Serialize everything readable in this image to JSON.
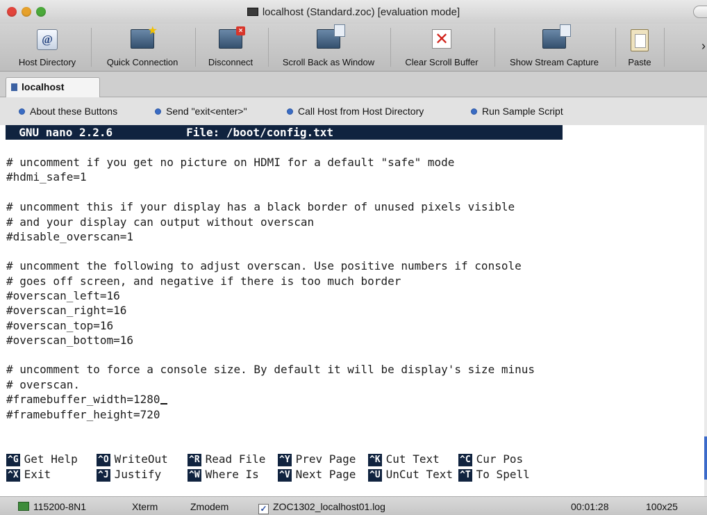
{
  "window": {
    "title": "localhost (Standard.zoc) [evaluation mode]"
  },
  "toolbar": {
    "buttons": [
      {
        "label": "Host Directory",
        "icon": "at-sign-icon"
      },
      {
        "label": "Quick Connection",
        "icon": "terminal-star-icon"
      },
      {
        "label": "Disconnect",
        "icon": "terminal-close-icon"
      },
      {
        "label": "Scroll Back as Window",
        "icon": "terminal-stack-icon"
      },
      {
        "label": "Clear Scroll Buffer",
        "icon": "red-x-icon"
      },
      {
        "label": "Show Stream Capture",
        "icon": "terminal-stack-icon"
      },
      {
        "label": "Paste",
        "icon": "clipboard-icon"
      }
    ],
    "more_glyph": "›"
  },
  "tabs": [
    {
      "label": "localhost"
    }
  ],
  "button_bar": {
    "items": [
      {
        "label": "About these Buttons"
      },
      {
        "label": "Send \"exit<enter>\""
      },
      {
        "label": "Call Host from Host Directory"
      },
      {
        "label": "Run Sample Script"
      }
    ]
  },
  "terminal": {
    "header": "  GNU nano 2.2.6           File: /boot/config.txt",
    "lines": [
      "# uncomment if you get no picture on HDMI for a default \"safe\" mode",
      "#hdmi_safe=1",
      "",
      "# uncomment this if your display has a black border of unused pixels visible",
      "# and your display can output without overscan",
      "#disable_overscan=1",
      "",
      "# uncomment the following to adjust overscan. Use positive numbers if console",
      "# goes off screen, and negative if there is too much border",
      "#overscan_left=16",
      "#overscan_right=16",
      "#overscan_top=16",
      "#overscan_bottom=16",
      "",
      "# uncomment to force a console size. By default it will be display's size minus",
      "# overscan.",
      "#framebuffer_width=1280",
      "#framebuffer_height=720"
    ],
    "shortcuts": [
      [
        {
          "key": "^G",
          "label": "Get Help"
        },
        {
          "key": "^O",
          "label": "WriteOut"
        },
        {
          "key": "^R",
          "label": "Read File"
        },
        {
          "key": "^Y",
          "label": "Prev Page"
        },
        {
          "key": "^K",
          "label": "Cut Text"
        },
        {
          "key": "^C",
          "label": "Cur Pos"
        }
      ],
      [
        {
          "key": "^X",
          "label": "Exit"
        },
        {
          "key": "^J",
          "label": "Justify"
        },
        {
          "key": "^W",
          "label": "Where Is"
        },
        {
          "key": "^V",
          "label": "Next Page"
        },
        {
          "key": "^U",
          "label": "UnCut Text"
        },
        {
          "key": "^T",
          "label": "To Spell"
        }
      ]
    ]
  },
  "status_bar": {
    "connection": "115200-8N1",
    "emulation": "Xterm",
    "transfer": "Zmodem",
    "log_file": "ZOC1302_localhost01.log",
    "log_checked": true,
    "elapsed": "00:01:28",
    "size": "100x25"
  }
}
